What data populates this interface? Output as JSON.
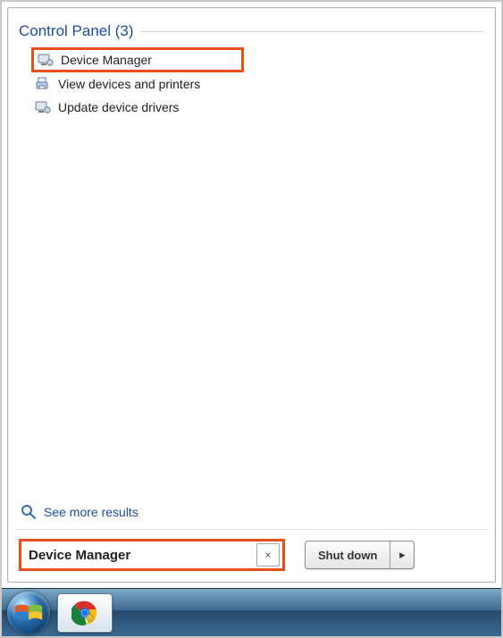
{
  "section": {
    "title": "Control Panel (3)"
  },
  "results": [
    {
      "label": "Device Manager",
      "highlighted": true,
      "icon": "device-manager"
    },
    {
      "label": "View devices and printers",
      "highlighted": false,
      "icon": "devices-printers"
    },
    {
      "label": "Update device drivers",
      "highlighted": false,
      "icon": "device-manager"
    }
  ],
  "see_more_label": "See more results",
  "search": {
    "value": "Device Manager",
    "clear_glyph": "×"
  },
  "shutdown": {
    "label": "Shut down",
    "arrow": "▸"
  }
}
